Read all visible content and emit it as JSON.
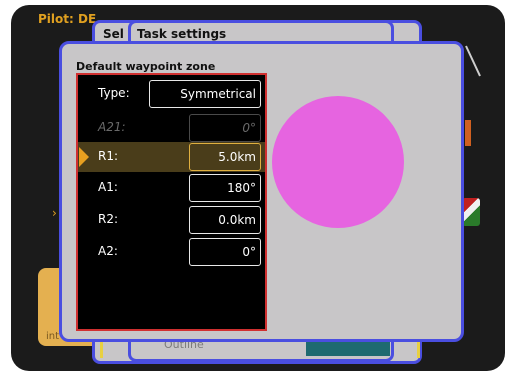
{
  "background": {
    "pilot_label": "Pilot: DE",
    "tile_text": "int",
    "chevron": "›",
    "footer_text": "Outline"
  },
  "stacked_dialogs": {
    "back_title": "Sel",
    "task_title": "Task settings"
  },
  "dialog": {
    "title": "Default waypoint zone",
    "fields": [
      {
        "label": "Type:",
        "value": "Symmetrical",
        "state": "normal"
      },
      {
        "label": "A21:",
        "value": "0°",
        "state": "disabled"
      },
      {
        "label": "R1:",
        "value": "5.0km",
        "state": "selected"
      },
      {
        "label": "A1:",
        "value": "180°",
        "state": "normal"
      },
      {
        "label": "R2:",
        "value": "0.0km",
        "state": "normal"
      },
      {
        "label": "A2:",
        "value": "0°",
        "state": "normal"
      }
    ],
    "zone_preview": {
      "shape": "circle",
      "fill": "#e664e0"
    }
  },
  "colors": {
    "dialog_border": "#4a4ee0",
    "panel_border": "#d03030",
    "selection": "#e8a020",
    "accent_text": "#e0a020"
  }
}
